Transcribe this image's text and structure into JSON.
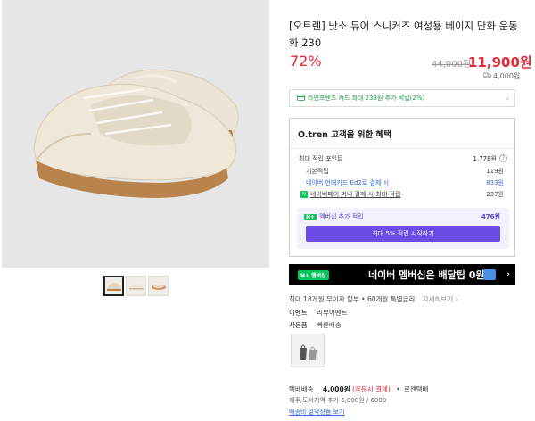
{
  "product": {
    "title": "[오트렌] 낫소 뮤어 스니커즈 여성용 베이지 단화 운동화 230",
    "discount": "72%",
    "original_price": "44,000원",
    "price": "11,900원",
    "shipping_fee": "4,000원"
  },
  "card_banner": {
    "text": "라인프렌즈 카드 최대 238원 추가 적립(2%)"
  },
  "benefit": {
    "heading": "O.tren 고객을 위한 혜택",
    "max_points_label": "최대 적립 포인트",
    "max_points_value": "1,778원",
    "basic_label": "기본적립",
    "basic_value": "119원",
    "hyundai_label": "네이버 현대카드 Ed2로 결제 시",
    "hyundai_value": "833원",
    "npay_label": "네이버페이 머니 결제 시 최대 적립",
    "npay_value": "237원",
    "membership_label": "멤버십 추가 적립",
    "membership_value": "476원",
    "membership_button": "최대 5% 적립 시작하기",
    "n_badge": "N+"
  },
  "naver_bar": {
    "logo": "N+ 멤버십",
    "text": "네이버 멤버십은 배달팁 0원"
  },
  "installment": {
    "text": "최대 18개월 무이자 할부 • 60개월 특별금리",
    "link": "자세히보기"
  },
  "event": {
    "label": "이벤트",
    "value": "리뷰이벤트"
  },
  "option": {
    "label": "사은품",
    "value": "빠른배송"
  },
  "delivery": {
    "method": "택배배송",
    "fee": "4,000원",
    "fee_note": "(주문시 결제)",
    "carrier": "로젠택배",
    "extra": "제주,도서지역 추가 6,000원 / 6000",
    "link": "배송비 절약상품 보기"
  },
  "colors": {
    "accent_red": "#e0293a",
    "naver_green": "#03c75a",
    "membership_purple": "#6b4ce6"
  }
}
